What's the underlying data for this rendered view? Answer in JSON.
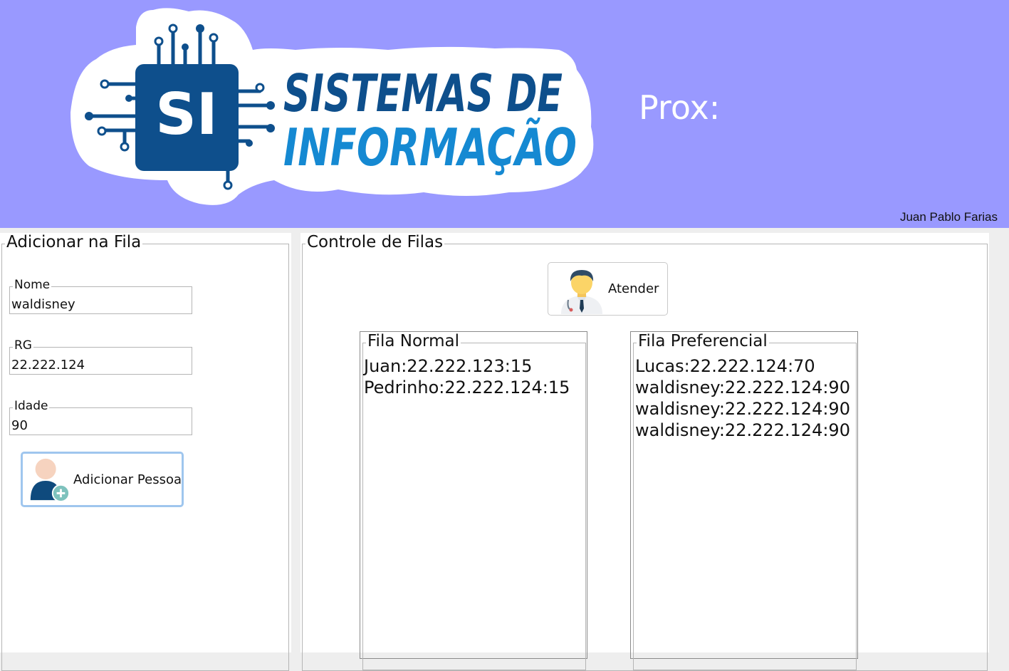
{
  "header": {
    "logo": {
      "badge": "SI",
      "line1": "SISTEMAS DE",
      "line2": "INFORMAÇÃO"
    },
    "prox_label": "Prox:",
    "author": "Juan Pablo Farias"
  },
  "add_panel": {
    "title": "Adicionar na Fila",
    "fields": [
      {
        "label": "Nome",
        "value": "waldisney"
      },
      {
        "label": "RG",
        "value": "22.222.124"
      },
      {
        "label": "Idade",
        "value": "90"
      }
    ],
    "add_button": {
      "label": "Adicionar Pessoa",
      "icon": "add-user-icon"
    }
  },
  "control_panel": {
    "title": "Controle de Filas",
    "attend_button": {
      "label": "Atender",
      "icon": "doctor-icon"
    },
    "normal_queue": {
      "title": "Fila Normal",
      "items": [
        "Juan:22.222.123:15",
        "Pedrinho:22.222.124:15"
      ]
    },
    "preferential_queue": {
      "title": "Fila Preferencial",
      "items": [
        "Lucas:22.222.124:70",
        "waldisney:22.222.124:90",
        "waldisney:22.222.124:90",
        "waldisney:22.222.124:90"
      ]
    }
  },
  "colors": {
    "header_bg": "#9999ff",
    "logo_dark_blue": "#0e4f8c",
    "logo_light_blue": "#1589d2",
    "focus_border": "#9fc6ee"
  }
}
